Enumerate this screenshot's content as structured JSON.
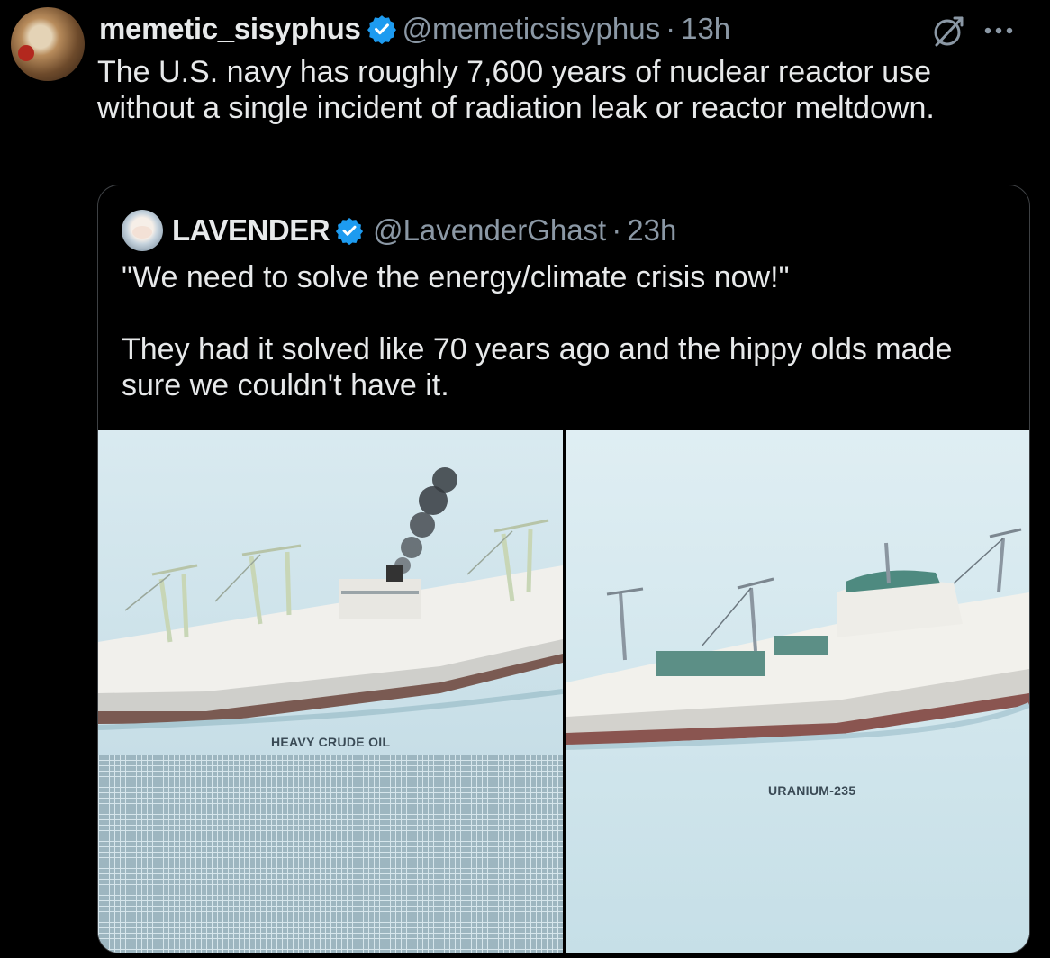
{
  "tweet": {
    "author_name": "memetic_sisyphus",
    "author_handle": "@memeticsisyphus",
    "separator": "·",
    "time": "13h",
    "more_icon": "more-horizontal-icon",
    "text": "The U.S. navy has roughly 7,600 years of nuclear reactor use without a single incident of radiation leak or reactor meltdown."
  },
  "quote": {
    "author_name": "LAVENDER",
    "author_handle": "@LavenderGhast",
    "separator": "·",
    "time": "23h",
    "text": "\"We need to solve the energy/climate crisis now!\"\n\nThey had it solved like 70 years ago and the hippy olds made sure we couldn't have it.",
    "media": [
      {
        "label": "HEAVY CRUDE OIL"
      },
      {
        "label": "URANIUM-235"
      }
    ]
  },
  "colors": {
    "background": "#000000",
    "text": "#e7e9ea",
    "secondary": "#8b98a5",
    "verified": "#1d9bf0",
    "border": "#3e4144"
  }
}
